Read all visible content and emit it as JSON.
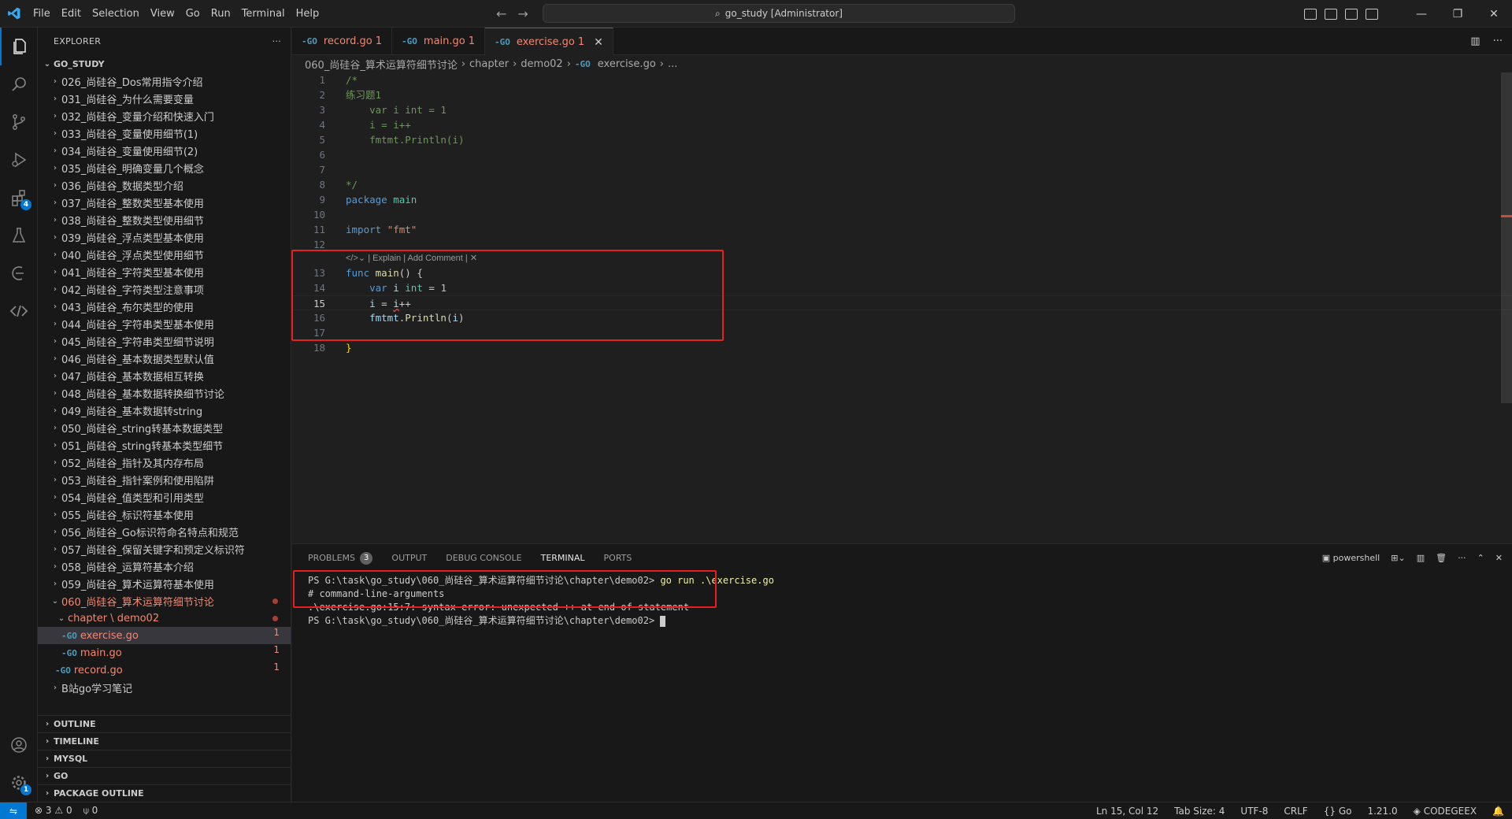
{
  "menu": [
    "File",
    "Edit",
    "Selection",
    "View",
    "Go",
    "Run",
    "Terminal",
    "Help"
  ],
  "command_center": "go_study [Administrator]",
  "explorer": {
    "title": "EXPLORER",
    "root": "GO_STUDY",
    "folders": [
      "026_尚硅谷_Dos常用指令介绍",
      "031_尚硅谷_为什么需要变量",
      "032_尚硅谷_变量介绍和快速入门",
      "033_尚硅谷_变量使用细节(1)",
      "034_尚硅谷_变量使用细节(2)",
      "035_尚硅谷_明确变量几个概念",
      "036_尚硅谷_数据类型介绍",
      "037_尚硅谷_整数类型基本使用",
      "038_尚硅谷_整数类型使用细节",
      "039_尚硅谷_浮点类型基本使用",
      "040_尚硅谷_浮点类型使用细节",
      "041_尚硅谷_字符类型基本使用",
      "042_尚硅谷_字符类型注意事项",
      "043_尚硅谷_布尔类型的使用",
      "044_尚硅谷_字符串类型基本使用",
      "045_尚硅谷_字符串类型细节说明",
      "046_尚硅谷_基本数据类型默认值",
      "047_尚硅谷_基本数据相互转换",
      "048_尚硅谷_基本数据转换细节讨论",
      "049_尚硅谷_基本数据转string",
      "050_尚硅谷_string转基本数据类型",
      "051_尚硅谷_string转基本类型细节",
      "052_尚硅谷_指针及其内存布局",
      "053_尚硅谷_指针案例和使用陷阱",
      "054_尚硅谷_值类型和引用类型",
      "055_尚硅谷_标识符基本使用",
      "056_尚硅谷_Go标识符命名特点和规范",
      "057_尚硅谷_保留关键字和预定义标识符",
      "058_尚硅谷_运算符基本介绍",
      "059_尚硅谷_算术运算符基本使用"
    ],
    "open_folder": "060_尚硅谷_算术运算符细节讨论",
    "subfolder": "chapter \\ demo02",
    "files": [
      {
        "name": "exercise.go",
        "count": "1"
      },
      {
        "name": "main.go",
        "count": "1"
      }
    ],
    "root_file": {
      "name": "record.go",
      "count": "1"
    },
    "last_folder": "B站go学习笔记",
    "sections": [
      "OUTLINE",
      "TIMELINE",
      "MYSQL",
      "GO",
      "PACKAGE OUTLINE"
    ]
  },
  "tabs": [
    {
      "name": "record.go",
      "count": "1"
    },
    {
      "name": "main.go",
      "count": "1"
    },
    {
      "name": "exercise.go",
      "count": "1"
    }
  ],
  "breadcrumb": [
    "060_尚硅谷_算术运算符细节讨论",
    "chapter",
    "demo02",
    "exercise.go",
    "..."
  ],
  "codelens": "| Explain | Add Comment |",
  "panel": {
    "tabs": [
      "PROBLEMS",
      "OUTPUT",
      "DEBUG CONSOLE",
      "TERMINAL",
      "PORTS"
    ],
    "problems_count": "3",
    "shell": "powershell",
    "terminal": [
      "PS G:\\task\\go_study\\060_尚硅谷_算术运算符细节讨论\\chapter\\demo02> ",
      "go run .\\exercise.go",
      "# command-line-arguments",
      ".\\exercise.go:15:7: syntax error: unexpected ++ at end of statement",
      "PS G:\\task\\go_study\\060_尚硅谷_算术运算符细节讨论\\chapter\\demo02> "
    ]
  },
  "status": {
    "errors": "3",
    "warnings": "0",
    "ports": "0",
    "position": "Ln 15, Col 12",
    "tab_size": "Tab Size: 4",
    "encoding": "UTF-8",
    "eol": "CRLF",
    "language": "Go",
    "go_version": "1.21.0",
    "ext": "CODEGEEX"
  },
  "colors": {
    "accent": "#0078d4",
    "error": "#f48771",
    "highlight_box": "#e81f1f"
  }
}
